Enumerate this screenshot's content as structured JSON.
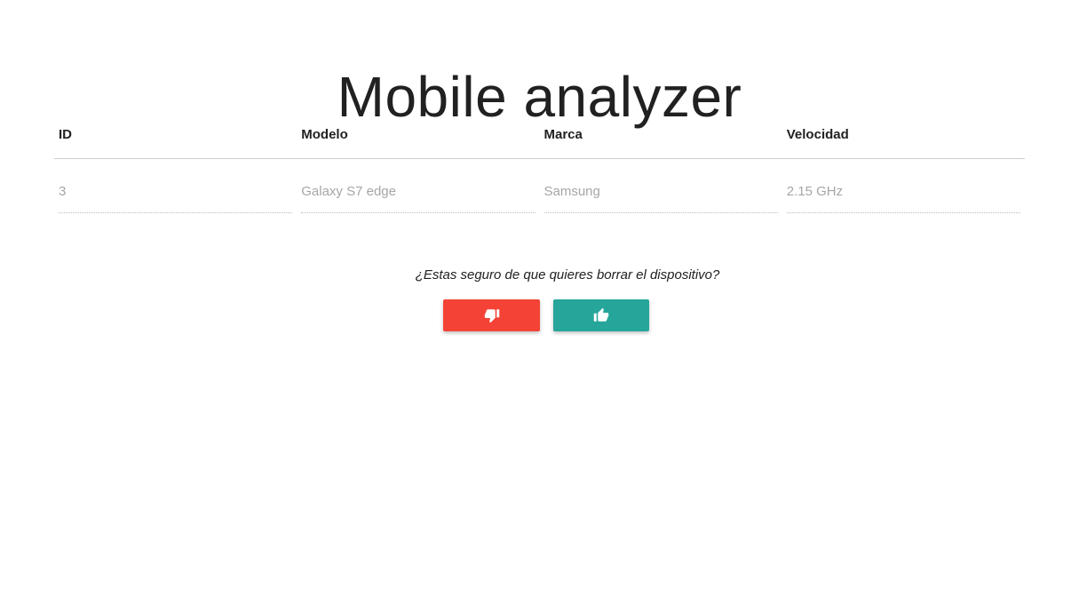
{
  "header": {
    "title": "Mobile analyzer"
  },
  "table": {
    "columns": [
      "ID",
      "Modelo",
      "Marca",
      "Velocidad"
    ],
    "row": [
      "3",
      "Galaxy S7 edge",
      "Samsung",
      "2.15 GHz"
    ]
  },
  "confirm": {
    "question": "¿Estas seguro de que quieres borrar el dispositivo?",
    "cancel_icon": "thumbs-down-icon",
    "accept_icon": "thumbs-up-icon"
  },
  "colors": {
    "cancel": "#f44336",
    "accept": "#26a69a"
  }
}
